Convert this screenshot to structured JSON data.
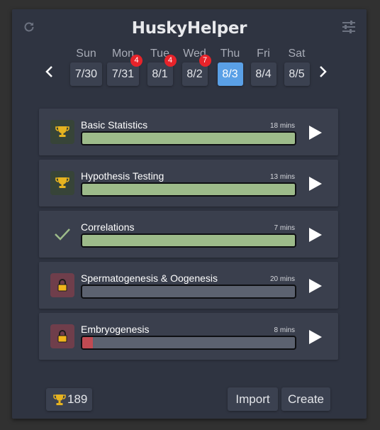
{
  "app": {
    "title": "HuskyHelper"
  },
  "icons": {
    "refresh": "refresh-icon",
    "settings": "sliders-icon",
    "prev": "chevron-left-icon",
    "next": "chevron-right-icon"
  },
  "days": [
    {
      "name": "Sun",
      "date": "7/30",
      "badge": null,
      "active": false
    },
    {
      "name": "Mon",
      "date": "7/31",
      "badge": "4",
      "active": false
    },
    {
      "name": "Tue",
      "date": "8/1",
      "badge": "4",
      "active": false
    },
    {
      "name": "Wed",
      "date": "8/2",
      "badge": "7",
      "active": false
    },
    {
      "name": "Thu",
      "date": "8/3",
      "badge": null,
      "active": true
    },
    {
      "name": "Fri",
      "date": "8/4",
      "badge": null,
      "active": false
    },
    {
      "name": "Sat",
      "date": "8/5",
      "badge": null,
      "active": false
    }
  ],
  "lessons": [
    {
      "name": "Basic Statistics",
      "duration": "18 mins",
      "status": "trophy",
      "progress": 1.0,
      "progress_color": "#9dbb8a"
    },
    {
      "name": "Hypothesis Testing",
      "duration": "13 mins",
      "status": "trophy",
      "progress": 1.0,
      "progress_color": "#9dbb8a"
    },
    {
      "name": "Correlations",
      "duration": "7 mins",
      "status": "check",
      "progress": 1.0,
      "progress_color": "#9dbb8a"
    },
    {
      "name": "Spermatogenesis & Oogenesis",
      "duration": "20 mins",
      "status": "locked",
      "progress": 0.0,
      "progress_color": "#c04a52"
    },
    {
      "name": "Embryogenesis",
      "duration": "8 mins",
      "status": "locked",
      "progress": 0.05,
      "progress_color": "#c04a52"
    }
  ],
  "footer": {
    "points": "189",
    "import_label": "Import",
    "create_label": "Create"
  },
  "colors": {
    "accent": "#5aa0e6",
    "badge": "#e8232a",
    "trophy": "#e6b320",
    "complete": "#9dbb8a",
    "locked_bg": "#6f3e4b"
  }
}
